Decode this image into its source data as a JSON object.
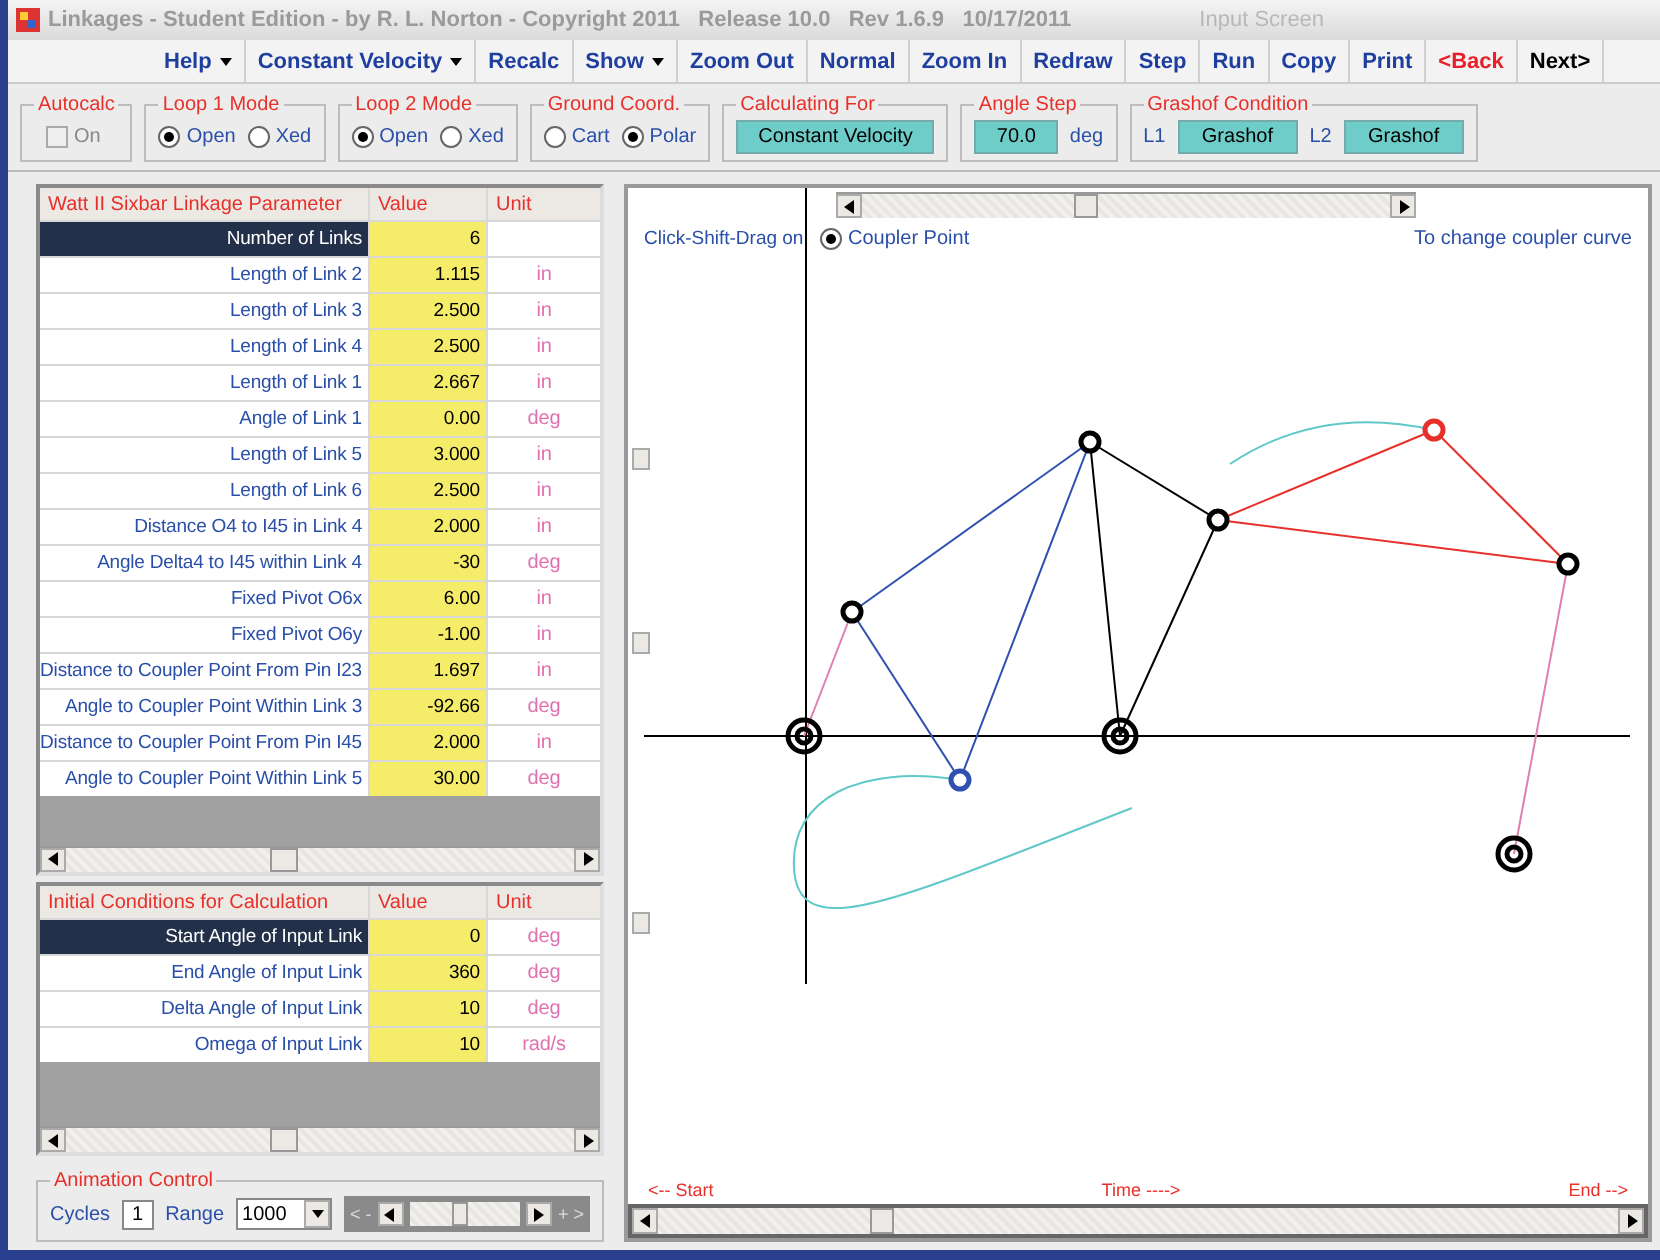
{
  "window": {
    "title": "Linkages - Student Edition - by R. L. Norton - Copyright 2011   Release 10.0   Rev 1.6.9   10/17/2011",
    "screen": "Input Screen"
  },
  "menu": [
    {
      "label": "Help",
      "kind": "dropdown",
      "color": "#1f3f9f"
    },
    {
      "label": "Constant Velocity",
      "kind": "dropdown",
      "color": "#1f3f9f"
    },
    {
      "label": "Recalc",
      "kind": "button",
      "color": "#1f3f9f"
    },
    {
      "label": "Show",
      "kind": "dropdown",
      "color": "#1f3f9f"
    },
    {
      "label": "Zoom Out",
      "kind": "button",
      "color": "#1f3f9f"
    },
    {
      "label": "Normal",
      "kind": "button",
      "color": "#1f3f9f"
    },
    {
      "label": "Zoom In",
      "kind": "button",
      "color": "#1f3f9f"
    },
    {
      "label": "Redraw",
      "kind": "button",
      "color": "#1f3f9f"
    },
    {
      "label": "Step",
      "kind": "button",
      "color": "#1f3f9f"
    },
    {
      "label": "Run",
      "kind": "button",
      "color": "#1f3f9f"
    },
    {
      "label": "Copy",
      "kind": "button",
      "color": "#1f3f9f"
    },
    {
      "label": "Print",
      "kind": "button",
      "color": "#1f3f9f"
    },
    {
      "label": "<Back",
      "kind": "button",
      "color": "#e8202a"
    },
    {
      "label": "Next>",
      "kind": "button",
      "color": "#000000"
    }
  ],
  "toolbar": {
    "autocalc": {
      "title": "Autocalc",
      "label": "On",
      "checked": false,
      "disabled": true
    },
    "loop1": {
      "title": "Loop 1 Mode",
      "options": [
        {
          "label": "Open",
          "selected": true
        },
        {
          "label": "Xed",
          "selected": false
        }
      ]
    },
    "loop2": {
      "title": "Loop 2 Mode",
      "options": [
        {
          "label": "Open",
          "selected": true
        },
        {
          "label": "Xed",
          "selected": false
        }
      ]
    },
    "ground": {
      "title": "Ground Coord.",
      "options": [
        {
          "label": "Cart",
          "selected": false
        },
        {
          "label": "Polar",
          "selected": true
        }
      ]
    },
    "calculating_for": {
      "title": "Calculating For",
      "value": "Constant Velocity"
    },
    "angle_step": {
      "title": "Angle Step",
      "value": "70.0",
      "unit": "deg"
    },
    "grashof": {
      "title": "Grashof Condition",
      "items": [
        {
          "label": "L1",
          "value": "Grashof"
        },
        {
          "label": "L2",
          "value": "Grashof"
        }
      ]
    }
  },
  "parameters": {
    "columns": [
      "Watt II Sixbar Linkage Parameter",
      "Value",
      "Unit"
    ],
    "rows": [
      {
        "label": "Number of Links",
        "value": "6",
        "selected": true
      },
      {
        "label": "Length of Link 2",
        "value": "1.115",
        "unit": "in",
        "selected": false
      },
      {
        "label": "Length of Link 3",
        "value": "2.500",
        "unit": "in",
        "selected": false
      },
      {
        "label": "Length of Link 4",
        "value": "2.500",
        "unit": "in",
        "selected": false
      },
      {
        "label": "Length of Link 1",
        "value": "2.667",
        "unit": "in",
        "selected": false
      },
      {
        "label": "Angle of Link 1",
        "value": "0.00",
        "unit": "deg",
        "selected": false
      },
      {
        "label": "Length of Link 5",
        "value": "3.000",
        "unit": "in",
        "selected": false
      },
      {
        "label": "Length of Link 6",
        "value": "2.500",
        "unit": "in",
        "selected": false
      },
      {
        "label": "Distance O4 to I45 in Link 4",
        "value": "2.000",
        "unit": "in",
        "selected": false
      },
      {
        "label": "Angle Delta4 to I45 within Link 4",
        "value": "-30",
        "unit": "deg",
        "selected": false
      },
      {
        "label": "Fixed Pivot O6x",
        "value": "6.00",
        "unit": "in",
        "selected": false
      },
      {
        "label": "Fixed Pivot O6y",
        "value": "-1.00",
        "unit": "in",
        "selected": false
      },
      {
        "label": "Distance to Coupler Point From Pin I23",
        "value": "1.697",
        "unit": "in",
        "selected": false
      },
      {
        "label": "Angle to Coupler Point Within Link 3",
        "value": "-92.66",
        "unit": "deg",
        "selected": false
      },
      {
        "label": "Distance to Coupler Point From Pin I45",
        "value": "2.000",
        "unit": "in",
        "selected": false
      },
      {
        "label": "Angle to Coupler Point Within Link 5",
        "value": "30.00",
        "unit": "deg",
        "selected": false
      }
    ]
  },
  "initial_conditions": {
    "columns": [
      "Initial Conditions for Calculation",
      "Value",
      "Unit"
    ],
    "rows": [
      {
        "label": "Start Angle of Input Link",
        "value": "0",
        "unit": "deg",
        "selected": true
      },
      {
        "label": "End Angle of Input Link",
        "value": "360",
        "unit": "deg",
        "selected": false
      },
      {
        "label": "Delta Angle of Input Link",
        "value": "10",
        "unit": "deg",
        "selected": false
      },
      {
        "label": "Omega of Input Link",
        "value": "10",
        "unit": "rad/s",
        "selected": false
      }
    ]
  },
  "animation": {
    "title": "Animation Control",
    "cycles_label": "Cycles",
    "cycles": "1",
    "range_label": "Range",
    "range": "1000",
    "slow_label": "< -",
    "fast_label": "+ >",
    "level": 0.45
  },
  "canvas": {
    "drag_label": "Click-Shift-Drag on",
    "drag_option": {
      "label": "Coupler Point",
      "selected": true
    },
    "hint": "To change coupler curve",
    "start_label": "<-- Start",
    "time_label": "Time ---->",
    "end_label": "End -->"
  }
}
